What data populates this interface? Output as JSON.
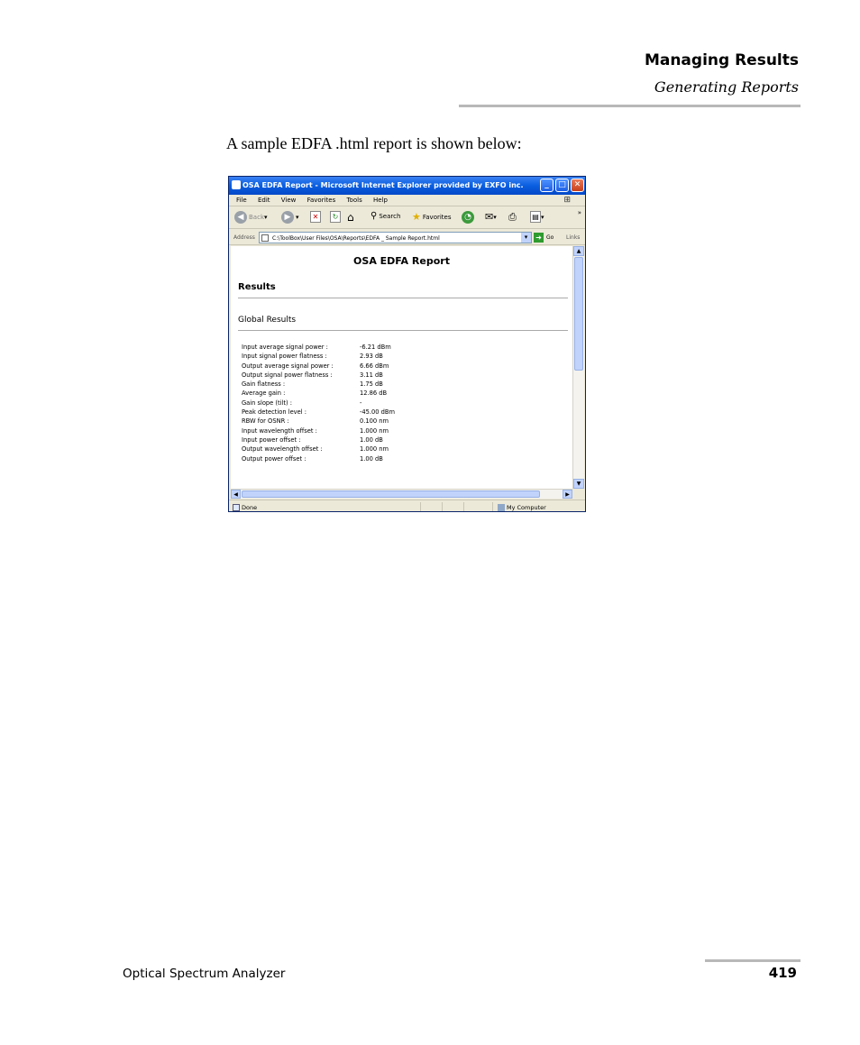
{
  "header": {
    "title": "Managing Results",
    "subtitle": "Generating Reports"
  },
  "intro": "A sample EDFA .html report is shown below:",
  "browser": {
    "window_title": "OSA EDFA Report - Microsoft Internet Explorer provided by EXFO inc.",
    "menu": [
      "File",
      "Edit",
      "View",
      "Favorites",
      "Tools",
      "Help"
    ],
    "toolbar": {
      "back": "Back",
      "search": "Search",
      "favorites": "Favorites"
    },
    "address_label": "Address",
    "address": "C:\\ToolBox\\User Files\\OSA\\Reports\\EDFA _ Sample Report.html",
    "go": "Go",
    "links": "Links",
    "status": {
      "left": "Done",
      "zone": "My Computer"
    }
  },
  "report": {
    "title": "OSA EDFA Report",
    "section": "Results",
    "subsection": "Global Results",
    "rows": [
      {
        "label": "Input average signal power :",
        "value": "-6.21 dBm"
      },
      {
        "label": "Input signal power flatness :",
        "value": "2.93 dB"
      },
      {
        "label": "Output average signal power :",
        "value": "6.66 dBm"
      },
      {
        "label": "Output signal power flatness :",
        "value": "3.11 dB"
      },
      {
        "label": "Gain flatness :",
        "value": "1.75 dB"
      },
      {
        "label": "Average gain :",
        "value": "12.86 dB"
      },
      {
        "label": "Gain slope (tilt) :",
        "value": "-"
      },
      {
        "label": "Peak detection level :",
        "value": "-45.00 dBm"
      },
      {
        "label": "RBW for OSNR :",
        "value": "0.100 nm"
      },
      {
        "label": "Input wavelength offset :",
        "value": "1.000 nm"
      },
      {
        "label": "Input power offset :",
        "value": "1.00 dB"
      },
      {
        "label": "Output wavelength offset :",
        "value": "1.000 nm"
      },
      {
        "label": "Output power offset :",
        "value": "1.00 dB"
      }
    ]
  },
  "footer": {
    "left": "Optical Spectrum Analyzer",
    "page": "419"
  }
}
